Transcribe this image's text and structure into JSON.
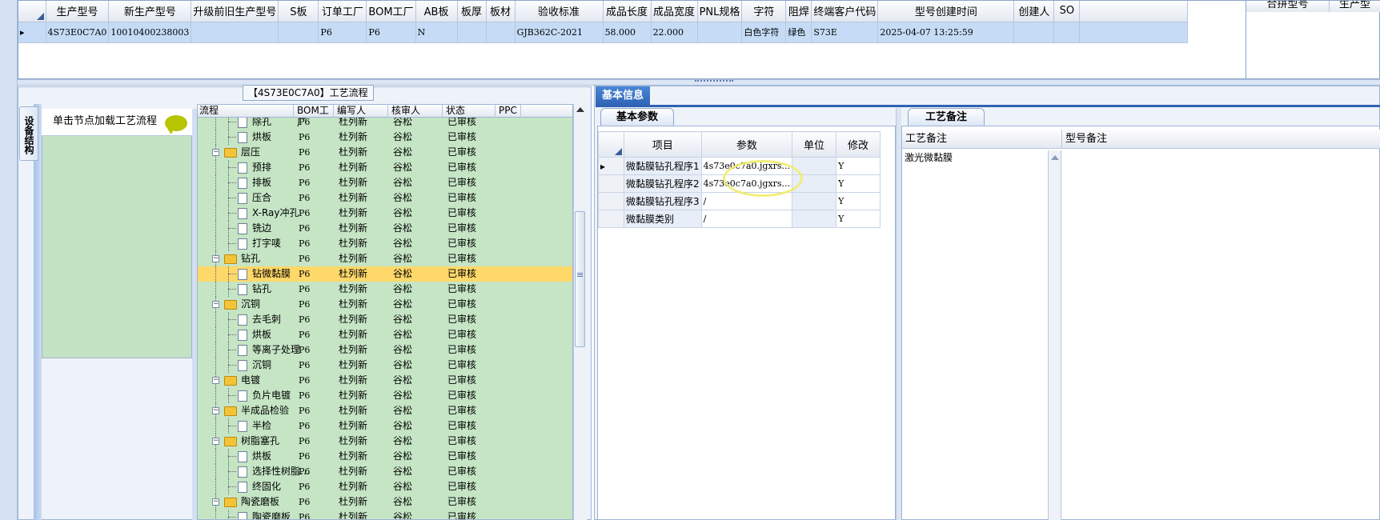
{
  "top_grid": {
    "columns": [
      "生产型号",
      "新生产型号",
      "升级前旧生产型号",
      "S板",
      "订单工厂",
      "BOM工厂",
      "AB板",
      "板厚",
      "板材",
      "验收标准",
      "成品长度",
      "成品宽度",
      "PNL规格",
      "字符",
      "阻焊",
      "终端客户代码",
      "型号创建时间",
      "创建人",
      "SO"
    ],
    "row": [
      "4S73E0C7A0",
      "10010400238003",
      "",
      "",
      "P6",
      "P6",
      "N",
      "",
      "",
      "GJB362C-2021",
      "58.000",
      "22.000",
      "",
      "白色字符",
      "绿色",
      "S73E",
      "2025-04-07 13:25:59",
      "",
      ""
    ]
  },
  "right_grid": {
    "columns": [
      "合拼型号",
      "生产型"
    ]
  },
  "process_panel": {
    "title": "【4S73E0C7A0】工艺流程",
    "side_tab": "设备结构",
    "hint": "单击节点加载工艺流程",
    "columns": [
      "流程",
      "BOM工厂",
      "编写人",
      "核审人",
      "状态",
      "PPC"
    ],
    "rows": [
      {
        "name": "除孔",
        "type": "doc",
        "bom": "P6",
        "writer": "杜列新",
        "reviewer": "谷松",
        "status": "已审核"
      },
      {
        "name": "烘板",
        "type": "doc",
        "bom": "P6",
        "writer": "杜列新",
        "reviewer": "谷松",
        "status": "已审核"
      },
      {
        "name": "层压",
        "type": "folder",
        "bom": "P6",
        "writer": "杜列新",
        "reviewer": "谷松",
        "status": "已审核"
      },
      {
        "name": "预排",
        "type": "doc",
        "bom": "P6",
        "writer": "杜列新",
        "reviewer": "谷松",
        "status": "已审核"
      },
      {
        "name": "排板",
        "type": "doc",
        "bom": "P6",
        "writer": "杜列新",
        "reviewer": "谷松",
        "status": "已审核"
      },
      {
        "name": "压合",
        "type": "doc",
        "bom": "P6",
        "writer": "杜列新",
        "reviewer": "谷松",
        "status": "已审核"
      },
      {
        "name": "X-Ray冲孔",
        "type": "doc",
        "bom": "P6",
        "writer": "杜列新",
        "reviewer": "谷松",
        "status": "已审核"
      },
      {
        "name": "铣边",
        "type": "doc",
        "bom": "P6",
        "writer": "杜列新",
        "reviewer": "谷松",
        "status": "已审核"
      },
      {
        "name": "打字唛",
        "type": "doc",
        "bom": "P6",
        "writer": "杜列新",
        "reviewer": "谷松",
        "status": "已审核"
      },
      {
        "name": "钻孔",
        "type": "folder",
        "bom": "P6",
        "writer": "杜列新",
        "reviewer": "谷松",
        "status": "已审核"
      },
      {
        "name": "钻微黏膜",
        "type": "doc",
        "bom": "P6",
        "writer": "杜列新",
        "reviewer": "谷松",
        "status": "已审核",
        "selected": true
      },
      {
        "name": "钻孔",
        "type": "doc",
        "bom": "P6",
        "writer": "杜列新",
        "reviewer": "谷松",
        "status": "已审核"
      },
      {
        "name": "沉铜",
        "type": "folder",
        "bom": "P6",
        "writer": "杜列新",
        "reviewer": "谷松",
        "status": "已审核"
      },
      {
        "name": "去毛刺",
        "type": "doc",
        "bom": "P6",
        "writer": "杜列新",
        "reviewer": "谷松",
        "status": "已审核"
      },
      {
        "name": "烘板",
        "type": "doc",
        "bom": "P6",
        "writer": "杜列新",
        "reviewer": "谷松",
        "status": "已审核"
      },
      {
        "name": "等离子处理",
        "type": "doc",
        "bom": "P6",
        "writer": "杜列新",
        "reviewer": "谷松",
        "status": "已审核"
      },
      {
        "name": "沉铜",
        "type": "doc",
        "bom": "P6",
        "writer": "杜列新",
        "reviewer": "谷松",
        "status": "已审核"
      },
      {
        "name": "电镀",
        "type": "folder",
        "bom": "P6",
        "writer": "杜列新",
        "reviewer": "谷松",
        "status": "已审核"
      },
      {
        "name": "负片电镀",
        "type": "doc",
        "bom": "P6",
        "writer": "杜列新",
        "reviewer": "谷松",
        "status": "已审核"
      },
      {
        "name": "半成品检验",
        "type": "folder",
        "bom": "P6",
        "writer": "杜列新",
        "reviewer": "谷松",
        "status": "已审核"
      },
      {
        "name": "半检",
        "type": "doc",
        "bom": "P6",
        "writer": "杜列新",
        "reviewer": "谷松",
        "status": "已审核"
      },
      {
        "name": "树脂塞孔",
        "type": "folder",
        "bom": "P6",
        "writer": "杜列新",
        "reviewer": "谷松",
        "status": "已审核"
      },
      {
        "name": "烘板",
        "type": "doc",
        "bom": "P6",
        "writer": "杜列新",
        "reviewer": "谷松",
        "status": "已审核"
      },
      {
        "name": "选择性树脂…",
        "type": "doc",
        "bom": "P6",
        "writer": "杜列新",
        "reviewer": "谷松",
        "status": "已审核"
      },
      {
        "name": "终固化",
        "type": "doc",
        "bom": "P6",
        "writer": "杜列新",
        "reviewer": "谷松",
        "status": "已审核"
      },
      {
        "name": "陶瓷磨板",
        "type": "folder",
        "bom": "P6",
        "writer": "杜列新",
        "reviewer": "谷松",
        "status": "已审核"
      },
      {
        "name": "陶瓷磨板",
        "type": "doc",
        "bom": "P6",
        "writer": "杜列新",
        "reviewer": "谷松",
        "status": "已审核"
      }
    ]
  },
  "basic_info": {
    "tab": "基本信息",
    "params_tab": "基本参数",
    "columns": [
      "项目",
      "参数",
      "单位",
      "修改"
    ],
    "rows": [
      {
        "item": "微黏膜钻孔程序1",
        "param": "4s73e0c7a0.jgxrs...",
        "unit": "",
        "mod": "Y"
      },
      {
        "item": "微黏膜钻孔程序2",
        "param": "4s73e0c7a0.jgxrs...",
        "unit": "",
        "mod": "Y"
      },
      {
        "item": "微黏膜钻孔程序3",
        "param": "/",
        "unit": "",
        "mod": "Y"
      },
      {
        "item": "微黏膜类别",
        "param": "/",
        "unit": "",
        "mod": "Y"
      }
    ]
  },
  "process_notes": {
    "tab": "工艺备注",
    "col1": "工艺备注",
    "col2": "型号备注",
    "note": "激光微黏膜"
  }
}
